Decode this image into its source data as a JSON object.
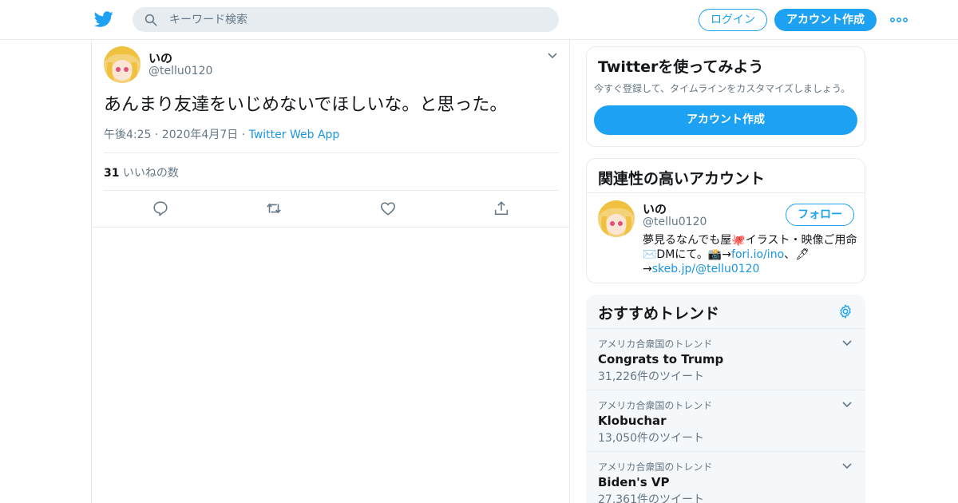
{
  "header": {
    "search_placeholder": "キーワード検索",
    "login_label": "ログイン",
    "signup_label": "アカウント作成"
  },
  "tweet": {
    "name": "いの",
    "handle": "@tellu0120",
    "text": "あんまり友達をいじめないでほしいな。と思った。",
    "time": "午後4:25 · 2020年4月7日 · ",
    "source": "Twitter Web App",
    "likes_count": "31",
    "likes_label": " いいねの数"
  },
  "signup_card": {
    "title": "Twitterを使ってみよう",
    "description": "今すぐ登録して、タイムラインをカスタマイズしましょう。",
    "button_label": "アカウント作成"
  },
  "related": {
    "title": "関連性の高いアカウント",
    "name": "いの",
    "handle": "@tellu0120",
    "follow_label": "フォロー",
    "bio_1": "夢見るなんでも屋🐙イラスト・映像ご用命✉️DMにて。📸→",
    "bio_link1": "fori.io/ino",
    "bio_2": "、🖋→",
    "bio_link2": "skeb.jp/@tellu0120"
  },
  "trends": {
    "title": "おすすめトレンド",
    "items": [
      {
        "context": "アメリカ合衆国のトレンド",
        "name": "Congrats to Trump",
        "count": "31,226件のツイート"
      },
      {
        "context": "アメリカ合衆国のトレンド",
        "name": "Klobuchar",
        "count": "13,050件のツイート"
      },
      {
        "context": "アメリカ合衆国のトレンド",
        "name": "Biden's VP",
        "count": "27,361件のツイート"
      }
    ]
  },
  "colors": {
    "accent": "#1da1f2",
    "link": "#1b95e0",
    "muted": "#657786",
    "border": "#e6ecf0",
    "trend_bg": "#f5f8fa"
  }
}
